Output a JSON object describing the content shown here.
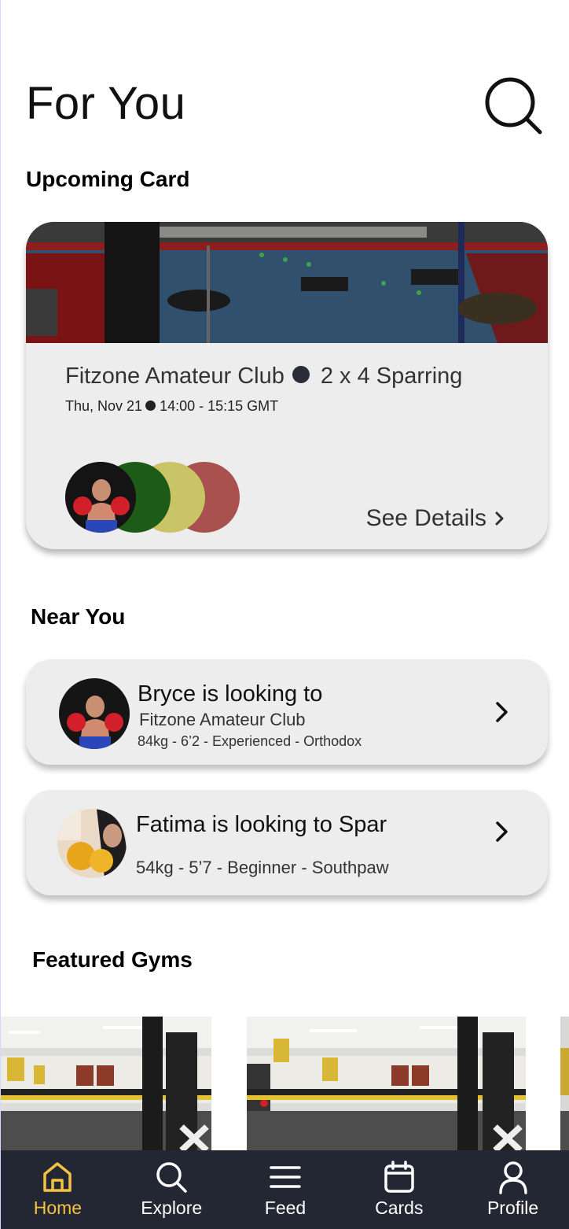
{
  "header": {
    "title": "For You"
  },
  "upcoming": {
    "section_title": "Upcoming Card",
    "club": "Fitzone Amateur Club",
    "event": "2 x 4 Sparring",
    "date": "Thu, Nov 21",
    "time": "14:00 - 15:15 GMT",
    "participant_colors": [
      "#1d5b18",
      "#c9c466",
      "#a9514f"
    ],
    "see_details": "See Details"
  },
  "near_you": {
    "section_title": "Near You",
    "items": [
      {
        "name_line": "Bryce is looking to",
        "club": "Fitzone Amateur Club",
        "stats": "84kg - 6’2 - Experienced - Orthodox"
      },
      {
        "name_line": "Fatima is looking to Spar",
        "stats": "54kg - 5’7 - Beginner - Southpaw"
      }
    ]
  },
  "featured": {
    "section_title": "Featured Gyms"
  },
  "nav": {
    "items": [
      {
        "label": "Home",
        "icon": "home-icon",
        "active": true
      },
      {
        "label": "Explore",
        "icon": "search-icon"
      },
      {
        "label": "Feed",
        "icon": "menu-icon"
      },
      {
        "label": "Cards",
        "icon": "calendar-icon"
      },
      {
        "label": "Profile",
        "icon": "user-icon"
      }
    ],
    "active_color": "#f3c342",
    "background": "#232733"
  }
}
